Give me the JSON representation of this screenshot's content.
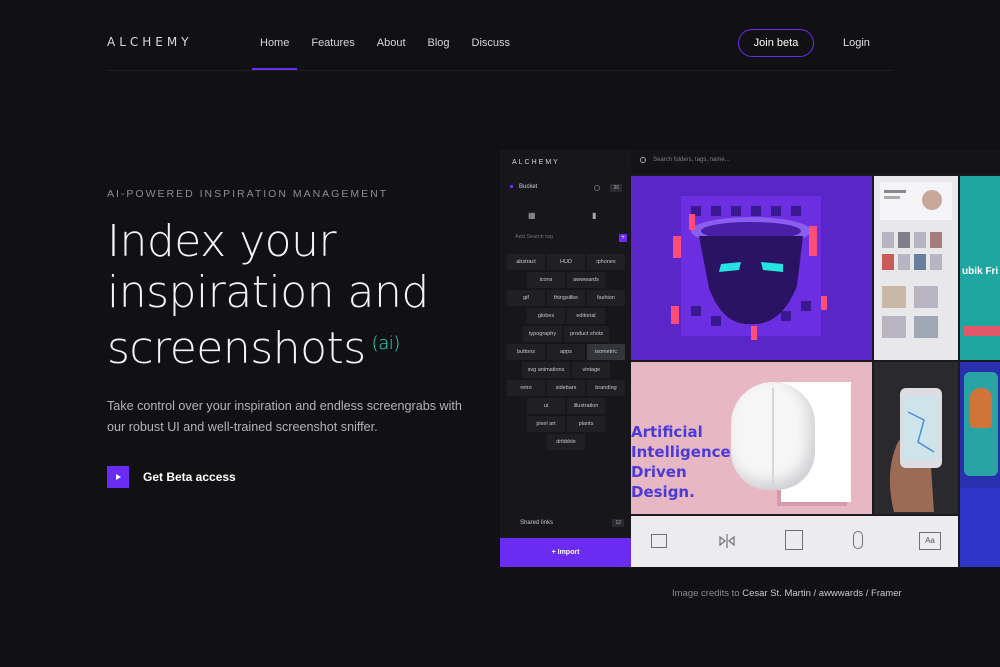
{
  "nav": {
    "logo": "ALCHEMY",
    "links": [
      "Home",
      "Features",
      "About",
      "Blog",
      "Discuss"
    ],
    "join_label": "Join beta",
    "login_label": "Login"
  },
  "hero": {
    "eyebrow": "AI-POWERED INSPIRATION MANAGEMENT",
    "headline_1": "Index your",
    "headline_2": "inspiration and",
    "headline_3": "screenshots",
    "ai_tag": "(ai)",
    "description": "Take control over your inspiration and endless screengrabs with our robust UI and well-trained screenshot sniffer.",
    "cta_label": "Get Beta access"
  },
  "app": {
    "logo": "ALCHEMY",
    "bucket_label": "Bucket",
    "bucket_count": "36",
    "tag_search_placeholder": "Add Search tag",
    "search_placeholder": "Search folders, tags, name...",
    "tags": [
      [
        "abstract",
        "HUD",
        "iphonex"
      ],
      [
        "icons",
        "awwwards"
      ],
      [
        "gif",
        "thingsilike",
        "fashion"
      ],
      [
        "globes",
        "editorial"
      ],
      [
        "typography",
        "product shots"
      ],
      [
        "buttons",
        "apps",
        "isometric"
      ],
      [
        "svg animations",
        "vintage"
      ],
      [
        "retro",
        "sidebars",
        "branding"
      ],
      [
        "ui",
        "illustration"
      ],
      [
        "pixel art",
        "plants"
      ],
      [
        "dribbble"
      ]
    ],
    "highlighted_tag": "isometric",
    "shared_links_label": "Shared links",
    "shared_links_count": "12",
    "import_label": "+ Import",
    "tile_text": "Artificial Intelligence Driven Design.",
    "tile_side_text": "ubik Fri",
    "aa_label": "Aa"
  },
  "credits": {
    "prefix": "Image credits to",
    "names": "Cesar St. Martin / awwwards / Framer"
  },
  "colors": {
    "accent": "#6a2cf2",
    "ai_tag": "#2fe0c8",
    "background": "#111113"
  }
}
